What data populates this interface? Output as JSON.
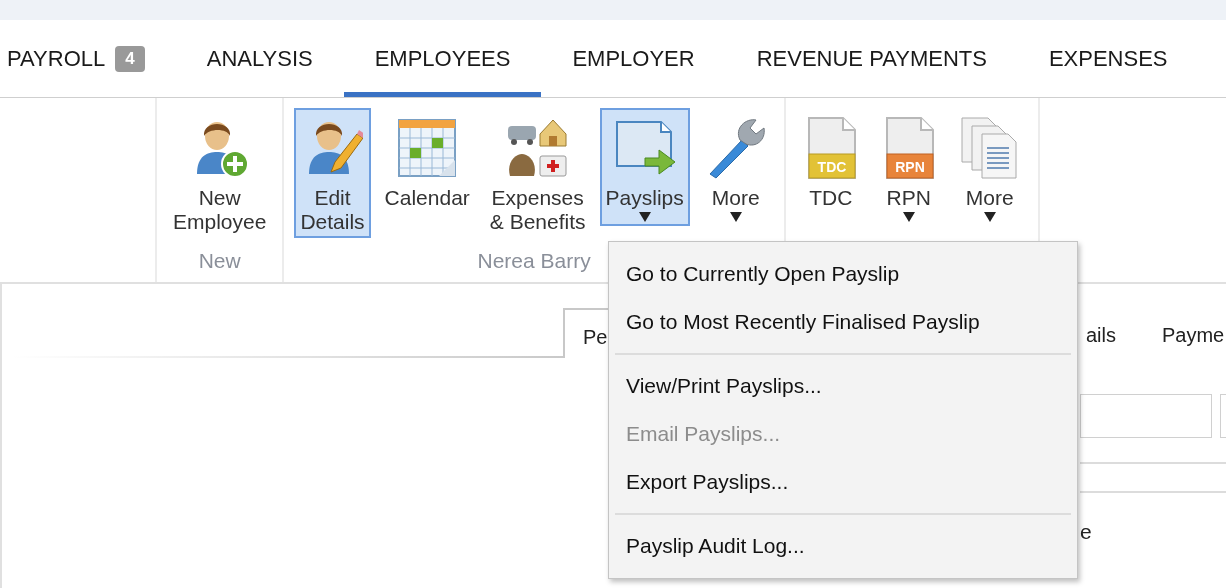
{
  "main_tabs": [
    {
      "label": "PAYROLL",
      "badge": "4",
      "selected": false
    },
    {
      "label": "ANALYSIS",
      "selected": false
    },
    {
      "label": "EMPLOYEES",
      "selected": true
    },
    {
      "label": "EMPLOYER",
      "selected": false
    },
    {
      "label": "REVENUE PAYMENTS",
      "selected": false
    },
    {
      "label": "EXPENSES",
      "selected": false
    }
  ],
  "ribbon_groups": [
    {
      "label": "New",
      "buttons": [
        {
          "lines": [
            "New",
            "Employee"
          ],
          "selected": false,
          "dropdown": false
        }
      ]
    },
    {
      "label": "Nerea Barry",
      "buttons": [
        {
          "lines": [
            "Edit",
            "Details"
          ],
          "selected": true,
          "dropdown": false
        },
        {
          "lines": [
            "Calendar"
          ],
          "selected": false,
          "dropdown": false
        },
        {
          "lines": [
            "Expenses",
            "& Benefits"
          ],
          "selected": false,
          "dropdown": false
        },
        {
          "lines": [
            "Payslips"
          ],
          "selected": true,
          "dropdown": true
        },
        {
          "lines": [
            "More"
          ],
          "selected": false,
          "dropdown": true
        }
      ]
    },
    {
      "buttons": [
        {
          "lines": [
            "TDC"
          ],
          "icon_text": "TDC",
          "selected": false,
          "dropdown": false
        },
        {
          "lines": [
            "RPN"
          ],
          "icon_text": "RPN",
          "selected": false,
          "dropdown": true
        },
        {
          "lines": [
            "More"
          ],
          "selected": false,
          "dropdown": true
        }
      ]
    }
  ],
  "background_tabs": [
    {
      "label": "Pe",
      "selected": true
    },
    {
      "label": "ails",
      "selected": false
    },
    {
      "label": "Payme",
      "selected": false
    }
  ],
  "background_label": "e",
  "payslips_menu": [
    {
      "kind": "item",
      "label": "Go to Currently Open Payslip",
      "disabled": false
    },
    {
      "kind": "item",
      "label": "Go to Most Recently Finalised Payslip",
      "disabled": false
    },
    {
      "kind": "separator"
    },
    {
      "kind": "item",
      "label": "View/Print Payslips...",
      "disabled": false
    },
    {
      "kind": "item",
      "label": "Email Payslips...",
      "disabled": true
    },
    {
      "kind": "item",
      "label": "Export Payslips...",
      "disabled": false
    },
    {
      "kind": "separator"
    },
    {
      "kind": "item",
      "label": "Payslip Audit Log...",
      "disabled": false
    }
  ]
}
